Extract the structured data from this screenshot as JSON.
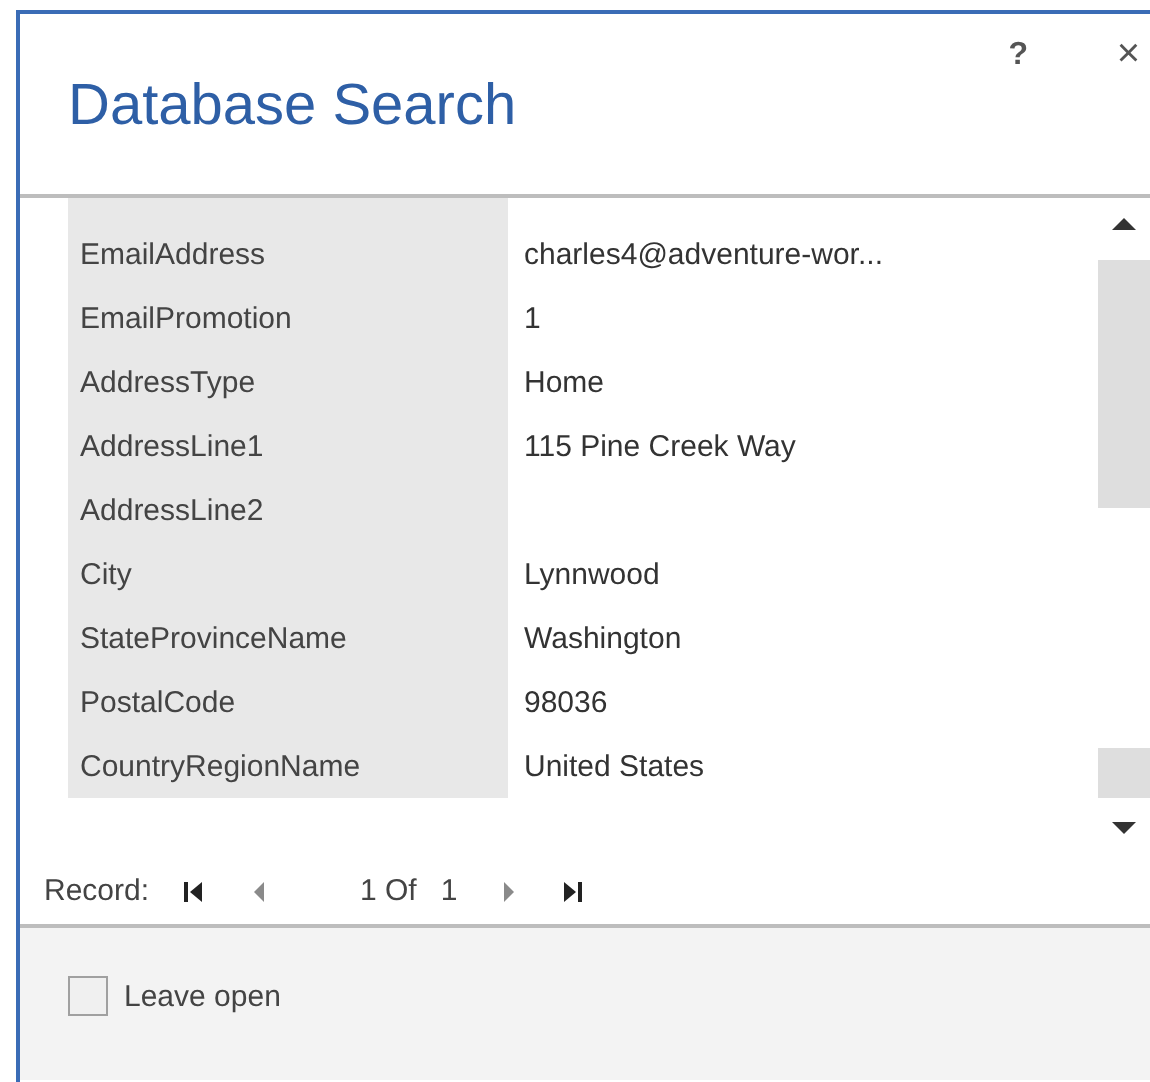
{
  "window": {
    "title": "Database Search",
    "help": "?",
    "close": "×"
  },
  "fields": [
    {
      "label": "EmailAddress",
      "value": "charles4@adventure-wor..."
    },
    {
      "label": "EmailPromotion",
      "value": "1"
    },
    {
      "label": "AddressType",
      "value": "Home"
    },
    {
      "label": "AddressLine1",
      "value": "115 Pine Creek Way"
    },
    {
      "label": "AddressLine2"
    },
    {
      "label": "City",
      "value": "Lynnwood"
    },
    {
      "label": "StateProvinceName",
      "value": "Washington"
    },
    {
      "label": "PostalCode",
      "value": "98036"
    },
    {
      "label": "CountryRegionName",
      "value": "United States"
    }
  ],
  "record_nav": {
    "label": "Record:",
    "position": "1 Of",
    "total": "1",
    "buttons": [
      {
        "kind": "first",
        "disabled": false
      },
      {
        "kind": "prev",
        "disabled": true
      },
      {
        "kind": "next",
        "disabled": true
      },
      {
        "kind": "last",
        "disabled": false
      }
    ]
  },
  "leave_open": {
    "label": "Leave open",
    "checked": false
  }
}
